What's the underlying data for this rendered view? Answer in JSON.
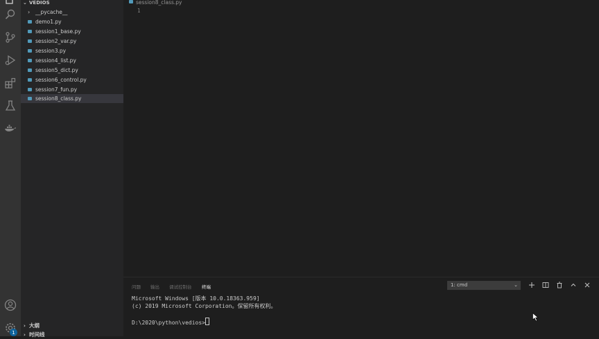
{
  "explorer": {
    "section_title": "VEDIOS",
    "items": [
      {
        "label": "__pycache__",
        "type": "folder"
      },
      {
        "label": "demo1.py",
        "type": "file"
      },
      {
        "label": "session1_base.py",
        "type": "file"
      },
      {
        "label": "session2_var.py",
        "type": "file"
      },
      {
        "label": "session3.py",
        "type": "file"
      },
      {
        "label": "session4_list.py",
        "type": "file"
      },
      {
        "label": "session5_dict.py",
        "type": "file"
      },
      {
        "label": "session6_control.py",
        "type": "file"
      },
      {
        "label": "session7_fun.py",
        "type": "file"
      },
      {
        "label": "session8_class.py",
        "type": "file",
        "selected": true
      }
    ],
    "outline_label": "大纲",
    "timeline_label": "时间线"
  },
  "activity_bar": {
    "icons": [
      "explorer-icon",
      "search-icon",
      "source-control-icon",
      "run-debug-icon",
      "extensions-icon",
      "testing-icon",
      "docker-icon",
      "account-icon",
      "settings-gear-icon"
    ],
    "settings_badge": "1"
  },
  "editor": {
    "active_tab": "session8_class.py",
    "line_numbers": [
      "1"
    ]
  },
  "panel": {
    "tabs": [
      "问题",
      "输出",
      "调试控制台",
      "终端"
    ],
    "active_tab": "终端",
    "terminal_selector": "1: cmd",
    "terminal_lines": [
      "Microsoft Windows [版本 10.0.18363.959]",
      "(c) 2019 Microsoft Corporation。保留所有权利。",
      "",
      "D:\\2020\\python\\vedios>"
    ]
  },
  "colors": {
    "activity_bar": "#333333",
    "sidebar": "#252526",
    "editor": "#1e1e1e",
    "selection": "#37373d",
    "python_icon": "#519aba",
    "badge": "#0e639c"
  }
}
